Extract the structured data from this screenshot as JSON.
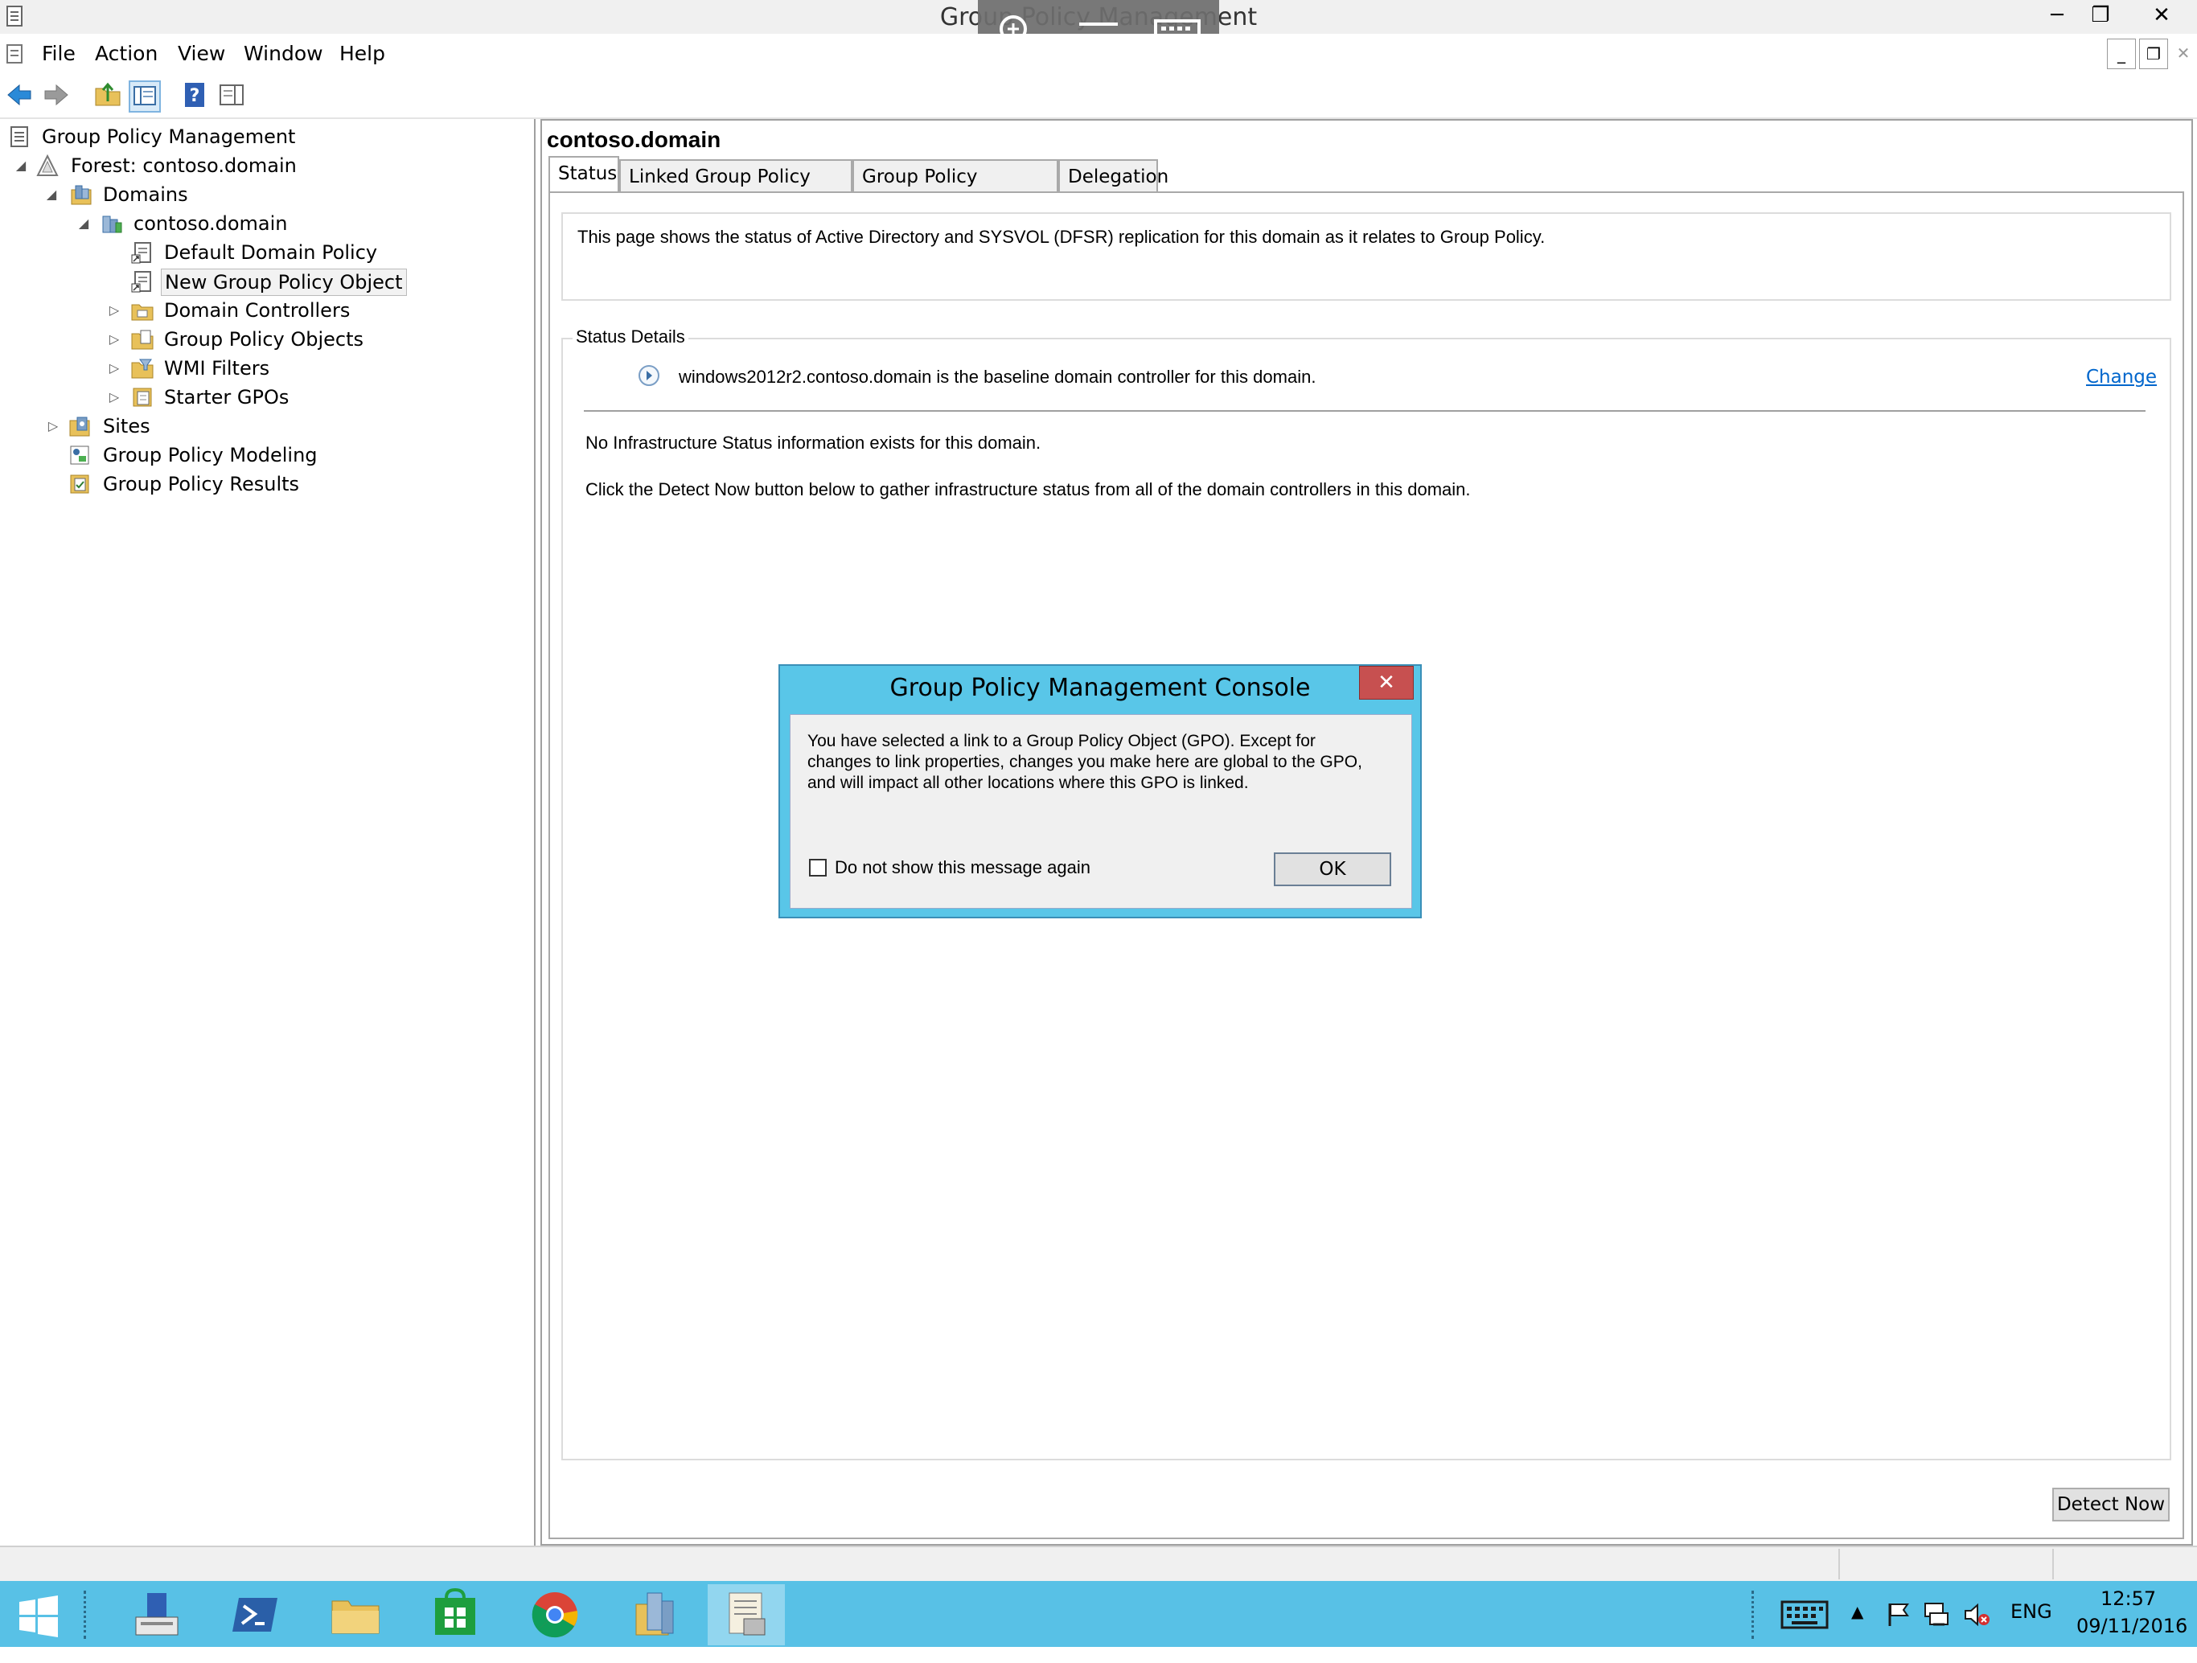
{
  "window": {
    "title": "Group Policy Management",
    "minimize_glyph": "─",
    "restore_glyph": "❐",
    "close_glyph": "✕",
    "child_minimize_glyph": "_",
    "child_restore_glyph": "❐",
    "child_close_glyph": "✕"
  },
  "overlay": {
    "zoom_icon": "zoom-icon",
    "menu_icon": "hamburger-icon",
    "keyboard_icon": "keyboard-icon"
  },
  "menubar": {
    "items": [
      "File",
      "Action",
      "View",
      "Window",
      "Help"
    ]
  },
  "toolbar": {
    "icons": [
      "back-arrow-icon",
      "forward-arrow-icon",
      "up-folder-icon",
      "show-hide-tree-icon",
      "help-icon",
      "action-pane-icon"
    ]
  },
  "tree": {
    "root": "Group Policy Management",
    "forest": "Forest: contoso.domain",
    "domains": "Domains",
    "domain": "contoso.domain",
    "default_policy": "Default Domain Policy",
    "new_gpo": "New Group Policy Object",
    "domain_controllers": "Domain Controllers",
    "gpo_folder": "Group Policy Objects",
    "wmi_filters": "WMI Filters",
    "starter_gpos": "Starter GPOs",
    "sites": "Sites",
    "modeling": "Group Policy Modeling",
    "results": "Group Policy Results"
  },
  "main": {
    "title": "contoso.domain",
    "tabs": [
      "Status",
      "Linked Group Policy Objects",
      "Group Policy Inheritance",
      "Delegation"
    ],
    "active_tab": "Status",
    "intro_text": "This page shows the status of Active Directory and SYSVOL (DFSR) replication for this domain as it relates to Group Policy.",
    "status_details_label": "Status Details",
    "baseline_text": "windows2012r2.contoso.domain is the baseline domain controller for this domain.",
    "change_link": "Change",
    "no_info_text": "No Infrastructure Status information exists for this domain.",
    "detect_hint_text": "Click the Detect Now button below to gather infrastructure status from all of the domain controllers in this domain.",
    "detect_button": "Detect Now"
  },
  "dialog": {
    "title": "Group Policy Management Console",
    "close_glyph": "✕",
    "message_line1": "You have selected a link to a Group Policy Object (GPO). Except for",
    "message_line2": "changes to link properties, changes you make here are global to the GPO,",
    "message_line3": "and will impact all other locations where this GPO is linked.",
    "checkbox_label": "Do not show this message again",
    "checkbox_checked": false,
    "ok_button": "OK"
  },
  "taskbar": {
    "apps": [
      "start-icon",
      "server-manager-icon",
      "powershell-icon",
      "file-explorer-icon",
      "store-icon",
      "chrome-icon",
      "admin-tools-icon",
      "gpmc-icon"
    ],
    "active_app": "gpmc-icon",
    "language": "ENG",
    "time": "12:57",
    "date": "09/11/2016",
    "accent_color": "#58c1e6"
  }
}
